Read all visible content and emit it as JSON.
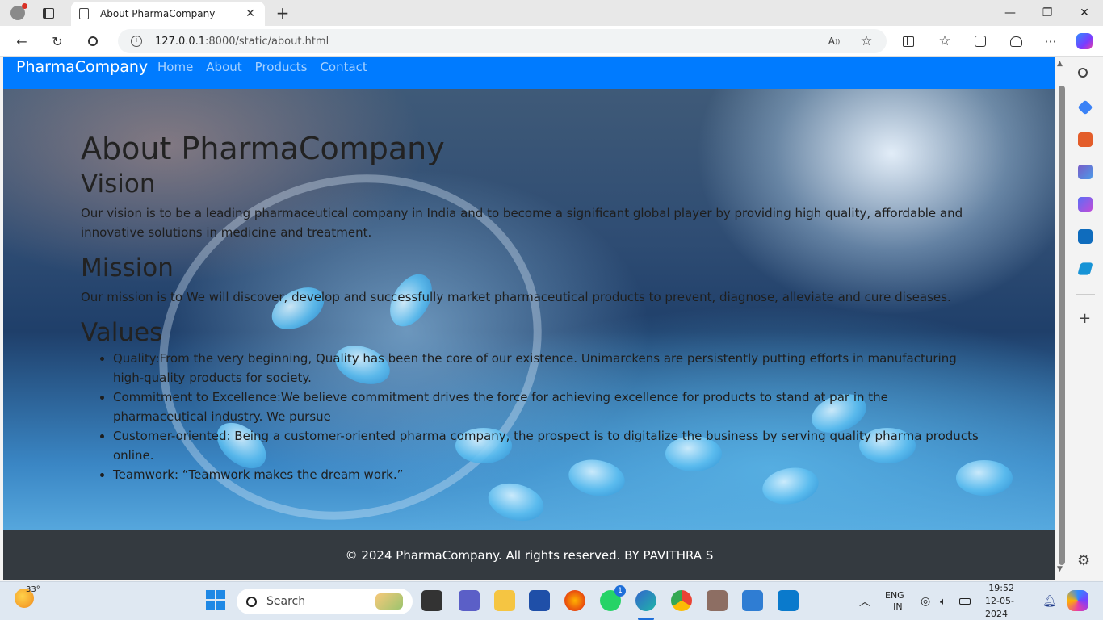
{
  "browser": {
    "tab_title": "About PharmaCompany",
    "url_host": "127.0.0.1",
    "url_rest": ":8000/static/about.html"
  },
  "site": {
    "brand": "PharmaCompany",
    "nav": [
      "Home",
      "About",
      "Products",
      "Contact"
    ],
    "heading": "About PharmaCompany",
    "vision_title": "Vision",
    "vision_text": "Our vision is to be a leading pharmaceutical company in India and to become a significant global player by providing high quality, affordable and innovative solutions in medicine and treatment.",
    "mission_title": "Mission",
    "mission_text": "Our mission is to We will discover, develop and successfully market pharmaceutical products to prevent, diagnose, alleviate and cure diseases.",
    "values_title": "Values",
    "values": [
      "Quality:From the very beginning, Quality has been the core of our existence. Unimarckens are persistently putting efforts in manufacturing high-quality products for society.",
      "Commitment to Excellence:We believe commitment drives the force for achieving excellence for products to stand at par in the pharmaceutical industry. We pursue",
      "Customer-oriented: Being a customer-oriented pharma company, the prospect is to digitalize the business by serving quality pharma products online.",
      "Teamwork: “Teamwork makes the dream work.”"
    ],
    "footer": "© 2024 PharmaCompany. All rights reserved. BY PAVITHRA S"
  },
  "taskbar": {
    "temperature": "33°",
    "search_placeholder": "Search",
    "whatsapp_badge": "1",
    "lang_top": "ENG",
    "lang_bottom": "IN",
    "time": "19:52",
    "date": "12-05-2024"
  },
  "colors": {
    "navbar": "#007bff",
    "footer": "#343a40"
  }
}
